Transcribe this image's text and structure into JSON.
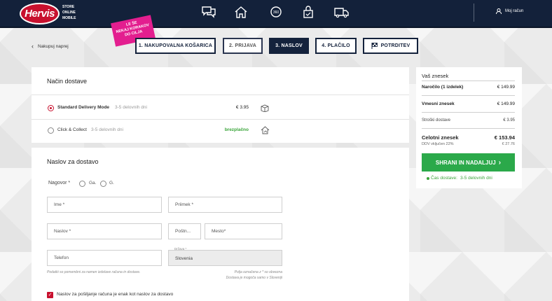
{
  "header": {
    "logo": "Hervis",
    "logo_sub": [
      "STORE",
      "ONLINE",
      "MOBILE"
    ],
    "icons": [
      "chat-icon",
      "home-icon",
      "360-icon",
      "lock-icon",
      "delivery-truck-icon"
    ],
    "icon_360_label": "360",
    "account_label": "Moj račun"
  },
  "nav": {
    "back_label": "Nakupuj naprej",
    "promo_text": [
      "LE ŠE",
      "NEKAJ KORAKOV",
      "DO CILJA"
    ],
    "steps": [
      {
        "label": "1.  NAKUPOVALNA KOŠARICA"
      },
      {
        "label": "2.  PRIJAVA"
      },
      {
        "label": "3.  NASLOV"
      },
      {
        "label": "4.  PLAČILO"
      },
      {
        "label": "POTRDITEV"
      }
    ]
  },
  "delivery": {
    "title": "Način dostave",
    "options": [
      {
        "name": "Standard Delivery Mode",
        "time": "3-5 delovnih dni",
        "price": "€ 3.95",
        "selected": true
      },
      {
        "name": "Click & Collect",
        "time": "3-5 delovnih dni",
        "price": "brezplačno",
        "selected": false
      }
    ]
  },
  "address": {
    "title": "Naslov za dostavo",
    "salutation_label": "Nagovor *",
    "salutation_options": [
      "Ga.",
      "G."
    ],
    "placeholders": {
      "first_name": "Ime *",
      "last_name": "Priimek *",
      "street": "Naslov *",
      "postal": "Poštn...",
      "city": "Mesto*",
      "phone": "Telefon"
    },
    "country_label": "Država *",
    "country_value": "Slovenia",
    "phone_hint": "Podatki so pomembni za namen izdelave računa in dostave.",
    "required_hint": [
      "Polja označena z * so obvezna",
      "Dostava je mogoča samo v Sloveniji"
    ],
    "billing_same_label": "Naslov za pošiljanje računa je enak kot naslov za dostavo",
    "billing_same_checked": true
  },
  "summary": {
    "title": "Vaš znesek",
    "order_label": "Naročilo (1 izdelek)",
    "order_value": "€ 149.99",
    "subtotal_label": "Vmesni znesek",
    "subtotal_value": "€ 149.99",
    "shipping_label": "Stroški dostave",
    "shipping_value": "€ 3.95",
    "total_label": "Celotni znesek",
    "total_value": "€ 153.94",
    "vat_label": "DDV vključen 22%",
    "vat_value": "€ 27.76",
    "button_label": "SHRANI IN NADALJUJ",
    "delivery_time_label": "Čas dostave:",
    "delivery_time_value": "3-5 delovnih dni"
  },
  "colors": {
    "header_bg": "#13213a",
    "brand_red": "#c8102e",
    "promo_pink": "#e31e8f",
    "accent_green": "#2ba94a"
  }
}
